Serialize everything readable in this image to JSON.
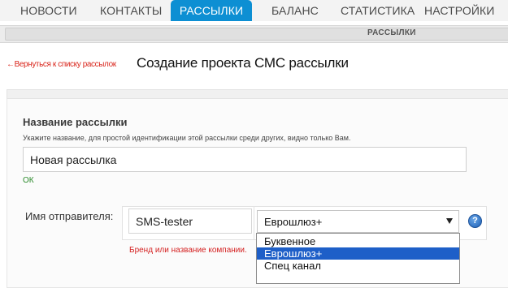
{
  "nav": {
    "items": [
      {
        "label": "НОВОСТИ"
      },
      {
        "label": "КОНТАКТЫ"
      },
      {
        "label": "РАССЫЛКИ"
      },
      {
        "label": "БАЛАНС"
      },
      {
        "label": "СТАТИСТИКА"
      },
      {
        "label": "НАСТРОЙКИ"
      }
    ],
    "active_item": "РАССЫЛКИ",
    "active_color": "#0d8fd3"
  },
  "subheader": {
    "label": "РАССЫЛКИ"
  },
  "page": {
    "back_link": "←Вернуться к списку рассылок",
    "title": "Создание проекта СМС рассылки"
  },
  "form": {
    "name_section": {
      "title": "Название рассылки",
      "hint": "Укажите название, для простой идентификации этой рассылки среди других, видно только Вам.",
      "value": "Новая рассылка",
      "status": "ОК",
      "status_color": "#2a8a2a"
    },
    "sender": {
      "label": "Имя отправителя:",
      "value": "SMS-tester",
      "type_selected": "Еврошлюз+",
      "type_options": [
        "Буквенное",
        "Еврошлюз+",
        "Спец канал"
      ],
      "help_icon": "question-circle-icon",
      "hint": "Бренд или название компании.",
      "hint_color": "#d41f1f"
    }
  }
}
